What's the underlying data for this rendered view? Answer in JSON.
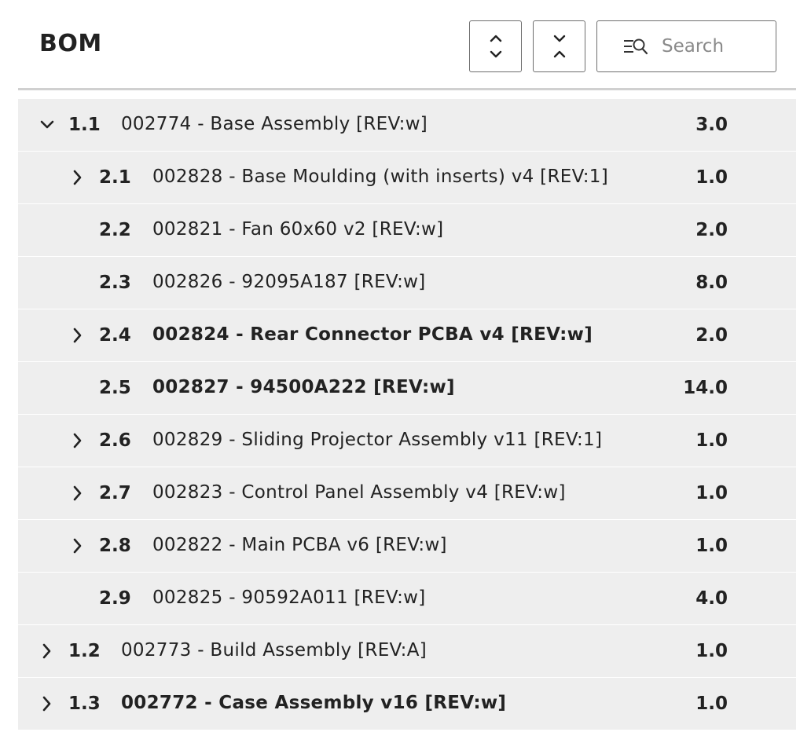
{
  "header": {
    "title": "BOM",
    "expand_all_icon": "chevrons-expand-icon",
    "collapse_all_icon": "chevrons-collapse-icon",
    "search": {
      "placeholder": "Search",
      "value": "",
      "icon": "search-list-icon"
    }
  },
  "rows": [
    {
      "num": "1.1",
      "label": "002774 - Base Assembly [REV:w]",
      "qty": "3.0",
      "level": 1,
      "chevron": "down",
      "bold": false
    },
    {
      "num": "2.1",
      "label": "002828 - Base Moulding (with inserts) v4 [REV:1]",
      "qty": "1.0",
      "level": 2,
      "chevron": "right",
      "bold": false
    },
    {
      "num": "2.2",
      "label": "002821 - Fan 60x60 v2 [REV:w]",
      "qty": "2.0",
      "level": 2,
      "chevron": "none",
      "bold": false
    },
    {
      "num": "2.3",
      "label": "002826 - 92095A187 [REV:w]",
      "qty": "8.0",
      "level": 2,
      "chevron": "none",
      "bold": false
    },
    {
      "num": "2.4",
      "label": "002824 - Rear Connector PCBA v4 [REV:w]",
      "qty": "2.0",
      "level": 2,
      "chevron": "right",
      "bold": true
    },
    {
      "num": "2.5",
      "label": "002827 - 94500A222 [REV:w]",
      "qty": "14.0",
      "level": 2,
      "chevron": "none",
      "bold": true
    },
    {
      "num": "2.6",
      "label": "002829 - Sliding Projector Assembly v11 [REV:1]",
      "qty": "1.0",
      "level": 2,
      "chevron": "right",
      "bold": false
    },
    {
      "num": "2.7",
      "label": "002823 - Control Panel Assembly v4 [REV:w]",
      "qty": "1.0",
      "level": 2,
      "chevron": "right",
      "bold": false
    },
    {
      "num": "2.8",
      "label": "002822 - Main PCBA v6 [REV:w]",
      "qty": "1.0",
      "level": 2,
      "chevron": "right",
      "bold": false
    },
    {
      "num": "2.9",
      "label": "002825 - 90592A011 [REV:w]",
      "qty": "4.0",
      "level": 2,
      "chevron": "none",
      "bold": false
    },
    {
      "num": "1.2",
      "label": "002773 - Build Assembly [REV:A]",
      "qty": "1.0",
      "level": 1,
      "chevron": "right",
      "bold": false
    },
    {
      "num": "1.3",
      "label": "002772 - Case Assembly v16 [REV:w]",
      "qty": "1.0",
      "level": 1,
      "chevron": "right",
      "bold": true
    }
  ]
}
